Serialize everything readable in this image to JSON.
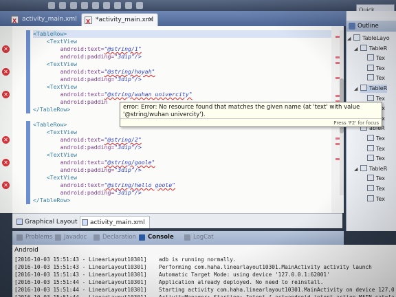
{
  "toolbar": {
    "quick_access": "Quick Access"
  },
  "tabs": [
    {
      "label": "activity_main.xml"
    },
    {
      "label": "*activity_main.xml"
    }
  ],
  "editor": {
    "lines": [
      {
        "indent": "",
        "text": "<TableRow>"
      },
      {
        "indent": "    ",
        "text": "<TextView"
      },
      {
        "indent": "        ",
        "attr": "android:text=",
        "val": "\"@string/1\""
      },
      {
        "indent": "        ",
        "attr": "android:padding=",
        "val": "\"3dip\"/>"
      },
      {
        "indent": "    ",
        "text": "<TextView"
      },
      {
        "indent": "        ",
        "attr": "android:text=",
        "val": "\"@string/hoyah\""
      },
      {
        "indent": "        ",
        "attr": "android:padding=",
        "val": "\"3dip\"/>"
      },
      {
        "indent": "    ",
        "text": "<TextView"
      },
      {
        "indent": "        ",
        "attr": "android:text=",
        "val": "\"@string/wuhan univercity\""
      },
      {
        "indent": "        ",
        "attr": "android:paddin",
        "val": ""
      },
      {
        "indent": "",
        "text": "</TableRow>"
      },
      {
        "indent": "",
        "text": ""
      },
      {
        "indent": "",
        "text": "<TableRow>"
      },
      {
        "indent": "    ",
        "text": "<TextView"
      },
      {
        "indent": "        ",
        "attr": "android:text=",
        "val": "\"@string/2\""
      },
      {
        "indent": "        ",
        "attr": "android:padding=",
        "val": "\"3dip\"/>"
      },
      {
        "indent": "    ",
        "text": "<TextView"
      },
      {
        "indent": "        ",
        "attr": "android:text=",
        "val": "\"@string/goole\""
      },
      {
        "indent": "        ",
        "attr": "android:padding=",
        "val": "\"3dip\"/>"
      },
      {
        "indent": "    ",
        "text": "<TextView"
      },
      {
        "indent": "        ",
        "attr": "android:text=",
        "val": "\"@string/hello goole\""
      },
      {
        "indent": "        ",
        "attr": "android:padding=",
        "val": "\"3dip\"/>"
      },
      {
        "indent": "",
        "text": "</TableRow>"
      }
    ],
    "tooltip": {
      "message": "error: Error: No resource found that matches the given name (at 'text' with value '@string/wuhan univercity').",
      "hint": "Press 'F2' for focus"
    }
  },
  "editor_tabs": {
    "graphical": "Graphical Layout",
    "xml": "activity_main.xml"
  },
  "console": {
    "tabs": [
      {
        "label": "Problems",
        "active": false
      },
      {
        "label": "Javadoc",
        "active": false
      },
      {
        "label": "Declaration",
        "active": false
      },
      {
        "label": "Console",
        "active": true
      },
      {
        "label": "LogCat",
        "active": false
      }
    ],
    "title": "Android",
    "lines": [
      {
        "stamp": "[2016-10-03 15:51:43 - LinearLayout10301]",
        "msg": "adb is running normally."
      },
      {
        "stamp": "[2016-10-03 15:51:43 - LinearLayout10301]",
        "msg": "Performing com.haha.linearlayout10301.MainActivity activity launch"
      },
      {
        "stamp": "[2016-10-03 15:51:43 - LinearLayout10301]",
        "msg": "Automatic Target Mode: using device '127.0.0.1:62001'"
      },
      {
        "stamp": "[2016-10-03 15:51:44 - LinearLayout10301]",
        "msg": "Application already deployed. No need to reinstall."
      },
      {
        "stamp": "[2016-10-03 15:51:44 - LinearLayout10301]",
        "msg": "Starting activity com.haha.linearlayout10301.MainActivity on device 127.0.0"
      },
      {
        "stamp": "[2016-10-03 15:51:44 - LinearLayout10301]",
        "msg": "ActivityManager: Starting: Intent { act=android.intent.action.MAIN cat=[and"
      }
    ]
  },
  "outline": {
    "title": "Outline",
    "nodes": [
      {
        "label": "TableLayo",
        "depth": 0,
        "twisty": "◢"
      },
      {
        "label": "TableR",
        "depth": 1,
        "twisty": "◢"
      },
      {
        "label": "Tex",
        "depth": 2
      },
      {
        "label": "Tex",
        "depth": 2
      },
      {
        "label": "Tex",
        "depth": 2
      },
      {
        "label": "TableR",
        "depth": 1,
        "twisty": "◢",
        "selected": true
      },
      {
        "label": "Tex",
        "depth": 2
      },
      {
        "label": "Tex",
        "depth": 2
      },
      {
        "label": "Tex",
        "depth": 2
      },
      {
        "label": "ableR",
        "depth": 1
      },
      {
        "label": "Tex",
        "depth": 2
      },
      {
        "label": "Tex",
        "depth": 2
      },
      {
        "label": "Tex",
        "depth": 2
      },
      {
        "label": "TableR",
        "depth": 1,
        "twisty": "◢"
      },
      {
        "label": "Tex",
        "depth": 2
      },
      {
        "label": "Tex",
        "depth": 2
      },
      {
        "label": "Tex",
        "depth": 2
      }
    ]
  }
}
